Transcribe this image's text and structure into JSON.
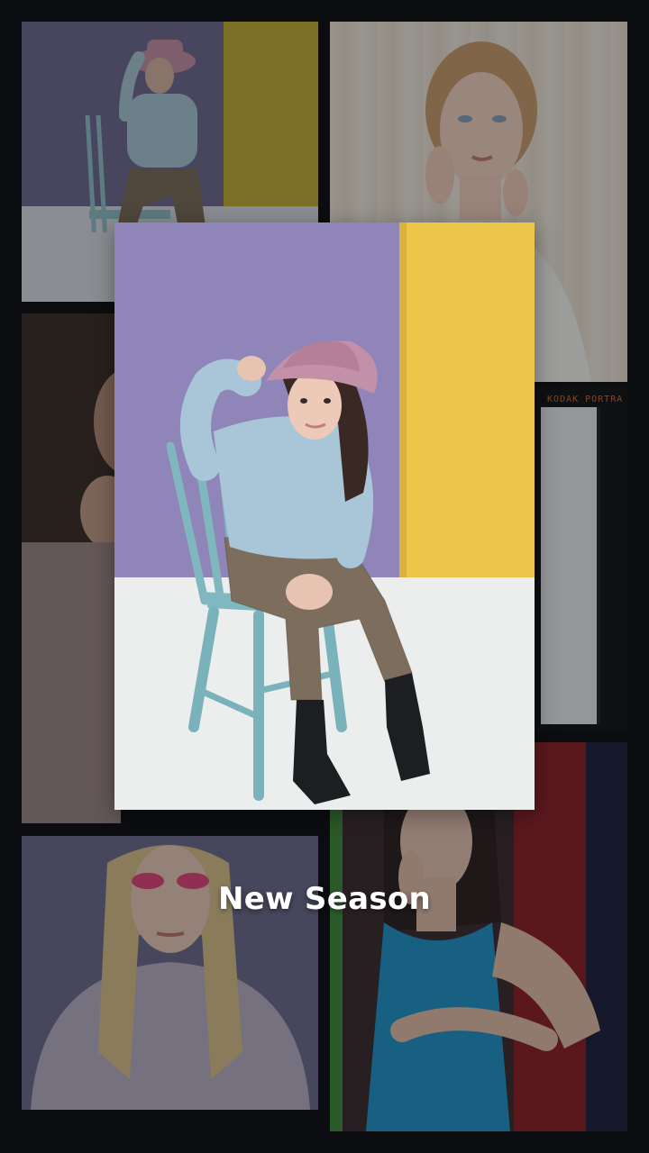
{
  "collage": {
    "caption": "New Season",
    "film_label": "KODAK PORTRA",
    "overlay_color": "#0a0c10"
  },
  "palette": {
    "background": "#0b0d10",
    "purple_wall": "#8f85b8",
    "yellow_wall": "#ecc648",
    "floor": "#eceeee",
    "film_orange": "#d46a2a"
  },
  "tiles": [
    {
      "id": "tile-top-left",
      "subject": "girl-in-pink-hat-on-blue-chair"
    },
    {
      "id": "tile-top-right",
      "subject": "woman-portrait-cream-curtain"
    },
    {
      "id": "tile-mid-left",
      "subject": "dark-portrait"
    },
    {
      "id": "tile-lower-left",
      "subject": "mauve-portrait"
    },
    {
      "id": "tile-right-film",
      "subject": "film-strip-frame"
    },
    {
      "id": "tile-bottom-left",
      "subject": "blonde-woman-pink-eye-makeup"
    },
    {
      "id": "tile-bottom-right",
      "subject": "woman-in-teal-dress"
    },
    {
      "id": "hero",
      "subject": "girl-in-pink-hat-on-blue-chair"
    }
  ]
}
